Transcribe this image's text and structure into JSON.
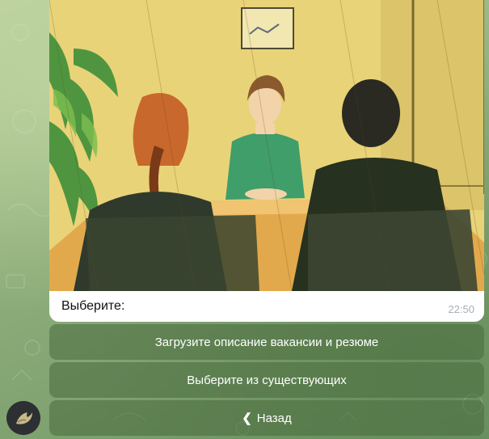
{
  "message": {
    "caption": "Выберите:",
    "time": "22:50",
    "image_icon": "interview-illustration"
  },
  "keyboard": {
    "buttons": [
      {
        "label": "Загрузите описание вакансии и резюме"
      },
      {
        "label": "Выберите из существующих"
      },
      {
        "label": "Назад",
        "icon": "back-chevron-icon"
      }
    ]
  },
  "avatar": {
    "icon": "bird-logo-icon"
  },
  "colors": {
    "chat_bg": "#8fae7b",
    "bubble_bg": "#ffffff",
    "button_bg": "#5a7a4c",
    "time_text": "#a6b0b7"
  }
}
